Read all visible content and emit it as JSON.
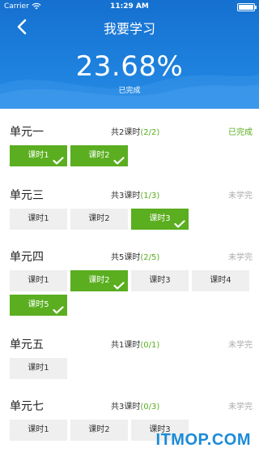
{
  "status_bar": {
    "carrier": "Carrier",
    "time": "11:29 AM"
  },
  "header": {
    "title": "我要学习",
    "percent": "23.68%",
    "subtitle": "已完成"
  },
  "units": [
    {
      "name": "单元一",
      "count_prefix": "共2课时",
      "count_progress": "(2/2)",
      "status": "已完成",
      "lessons": [
        {
          "label": "课时1",
          "done": true
        },
        {
          "label": "课时2",
          "done": true
        }
      ]
    },
    {
      "name": "单元三",
      "count_prefix": "共3课时",
      "count_progress": "(1/3)",
      "status": "未学完",
      "lessons": [
        {
          "label": "课时1",
          "done": false
        },
        {
          "label": "课时2",
          "done": false
        },
        {
          "label": "课时3",
          "done": true
        }
      ]
    },
    {
      "name": "单元四",
      "count_prefix": "共5课时",
      "count_progress": "(2/5)",
      "status": "未学完",
      "lessons": [
        {
          "label": "课时1",
          "done": false
        },
        {
          "label": "课时2",
          "done": true
        },
        {
          "label": "课时3",
          "done": false
        },
        {
          "label": "课时4",
          "done": false
        },
        {
          "label": "课时5",
          "done": true
        }
      ]
    },
    {
      "name": "单元五",
      "count_prefix": "共1课时",
      "count_progress": "(0/1)",
      "status": "未学完",
      "lessons": [
        {
          "label": "课时1",
          "done": false
        }
      ]
    },
    {
      "name": "单元七",
      "count_prefix": "共3课时",
      "count_progress": "(0/3)",
      "status": "未学完",
      "lessons": [
        {
          "label": "课时1",
          "done": false
        },
        {
          "label": "课时2",
          "done": false
        },
        {
          "label": "课时3",
          "done": false
        }
      ]
    }
  ],
  "watermark": "ITMOP.COM",
  "colors": {
    "header_blue": "#1f83df",
    "done_green": "#5aae1f",
    "pending_gray": "#efefef"
  }
}
